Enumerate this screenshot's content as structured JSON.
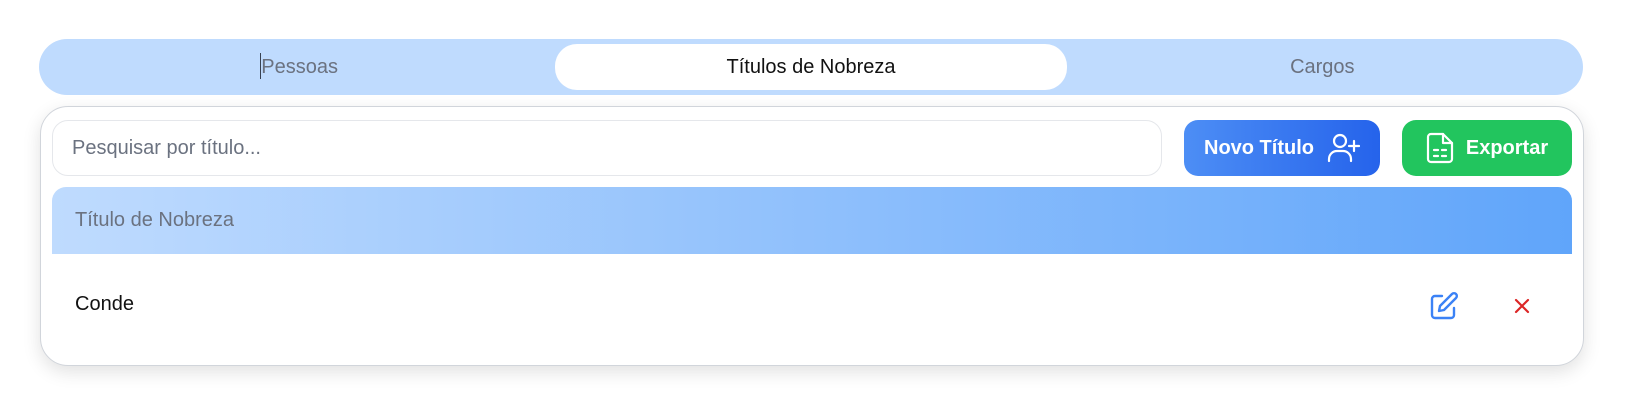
{
  "tabs": [
    {
      "label": "Pessoas",
      "active": false
    },
    {
      "label": "Títulos de Nobreza",
      "active": true
    },
    {
      "label": "Cargos",
      "active": false
    }
  ],
  "search": {
    "placeholder": "Pesquisar por título...",
    "value": ""
  },
  "toolbar": {
    "new_label": "Novo Título",
    "new_icon": "user-plus-icon",
    "export_label": "Exportar",
    "export_icon": "spreadsheet-file-icon"
  },
  "table": {
    "header": "Título de Nobreza",
    "rows": [
      {
        "title": "Conde",
        "actions": [
          "edit-icon",
          "close-icon"
        ]
      }
    ]
  },
  "colors": {
    "tabs_bg": "#bfdbfe",
    "primary": "#2563eb",
    "export": "#22c55e",
    "delete": "#dc2626"
  }
}
